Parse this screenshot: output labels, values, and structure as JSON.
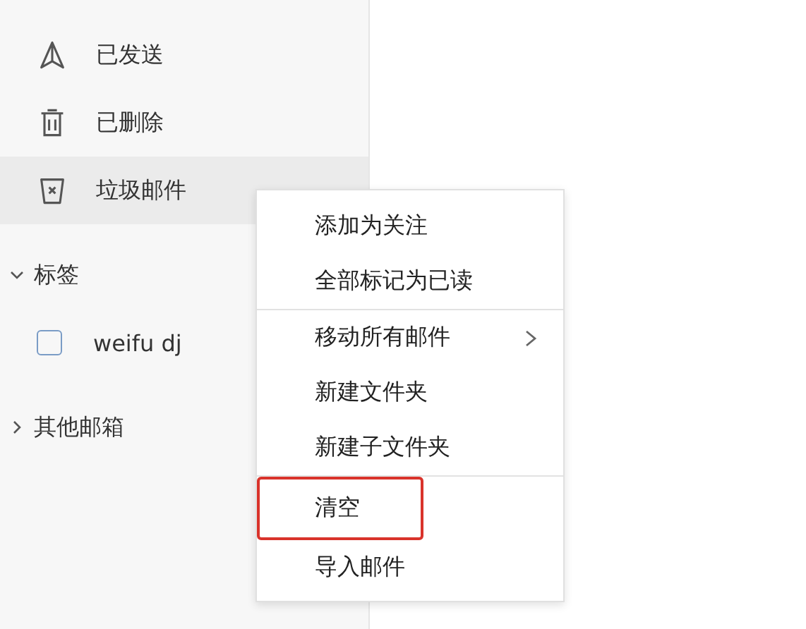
{
  "sidebar": {
    "folders": [
      {
        "kind": "sent",
        "label": "已发送",
        "selected": false
      },
      {
        "kind": "deleted",
        "label": "已删除",
        "selected": false
      },
      {
        "kind": "junk",
        "label": "垃圾邮件",
        "selected": true
      }
    ],
    "tags": {
      "label": "标签",
      "expanded": true,
      "items": [
        {
          "label": "weifu dj",
          "checked": false
        }
      ]
    },
    "other": {
      "label": "其他邮箱"
    }
  },
  "context_menu": {
    "groups": [
      [
        {
          "label": "添加为关注"
        },
        {
          "label": "全部标记为已读"
        }
      ],
      [
        {
          "label": "移动所有邮件",
          "submenu": true
        },
        {
          "label": "新建文件夹"
        },
        {
          "label": "新建子文件夹"
        }
      ],
      [
        {
          "label": "清空",
          "highlighted": true
        },
        {
          "label": "导入邮件"
        }
      ]
    ]
  }
}
